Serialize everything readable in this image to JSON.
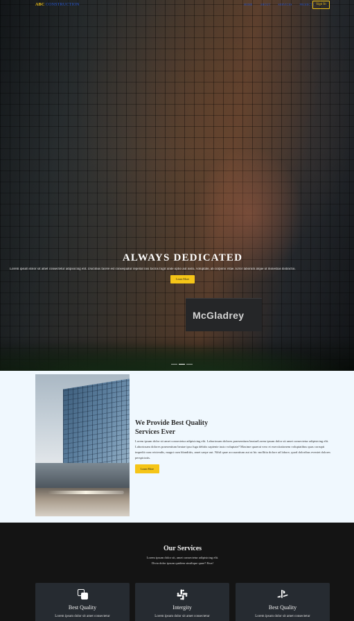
{
  "brand": {
    "part1": "ABC",
    "part2": "CONSTRUCTION"
  },
  "nav": {
    "items": [
      "HOME",
      "ABOUT",
      "SERVICES",
      "PROJECTS"
    ],
    "signin": "Sign In"
  },
  "hero": {
    "sign_text": "McGladrey",
    "title": "ALWAYS DEDICATED",
    "text": "Lorem ipsum dolor sit amet consectetur adipisicing elit. Ducimus facere est consequatur repellat nisi facilis fugit unde optio aut iusto, voluptate, ab corporis vitae. Error laborum atque ut molestias distinctio.",
    "button": "Learn More"
  },
  "about": {
    "title": "We Provide Best Quality Services Ever",
    "text": "Lorem ipsum dolor sit amet consectetur adipisicing elit. Laboriosam dolores praesentium beataeLorem ipsum dolor sit amet consectetur adipisicing elit. Laboriosam dolores praesentium beatae ipsa fuga debitis sapiente iusto voluptate? Maxime quaerat vero et exercitationem voluptatibus quas corrupti impedit cum reiciendis, magni cum blanditiis, amet saepe aut. Nihil quae accusantium aut ut hic mollitia dolore ad labore, quod doloribus eveniet dolores perspiciatis.",
    "button": "Learn More"
  },
  "services": {
    "title": "Our Services",
    "subtitle_line1": "Lorem ipsum dolor sit, amet consectetur adipisicing elit.",
    "subtitle_line2": "Dicta dolor ipsum quidem similique quae? Eius!",
    "cards": [
      {
        "icon": "copy-icon",
        "title": "Best Quality",
        "text": "Lorem ipsum dolor sit amet consectetur"
      },
      {
        "icon": "slack-icon",
        "title": "Intergity",
        "text": "Lorem ipsum dolor sit amet consectetur"
      },
      {
        "icon": "playstation-icon",
        "title": "Best Quality",
        "text": "Lorem ipsum dolor sit amet consectetur"
      }
    ]
  },
  "colors": {
    "accent": "#f5c518",
    "link": "#2b5bd7",
    "dark": "#141414",
    "card": "#262b31",
    "about_bg": "#f0f8fe"
  }
}
